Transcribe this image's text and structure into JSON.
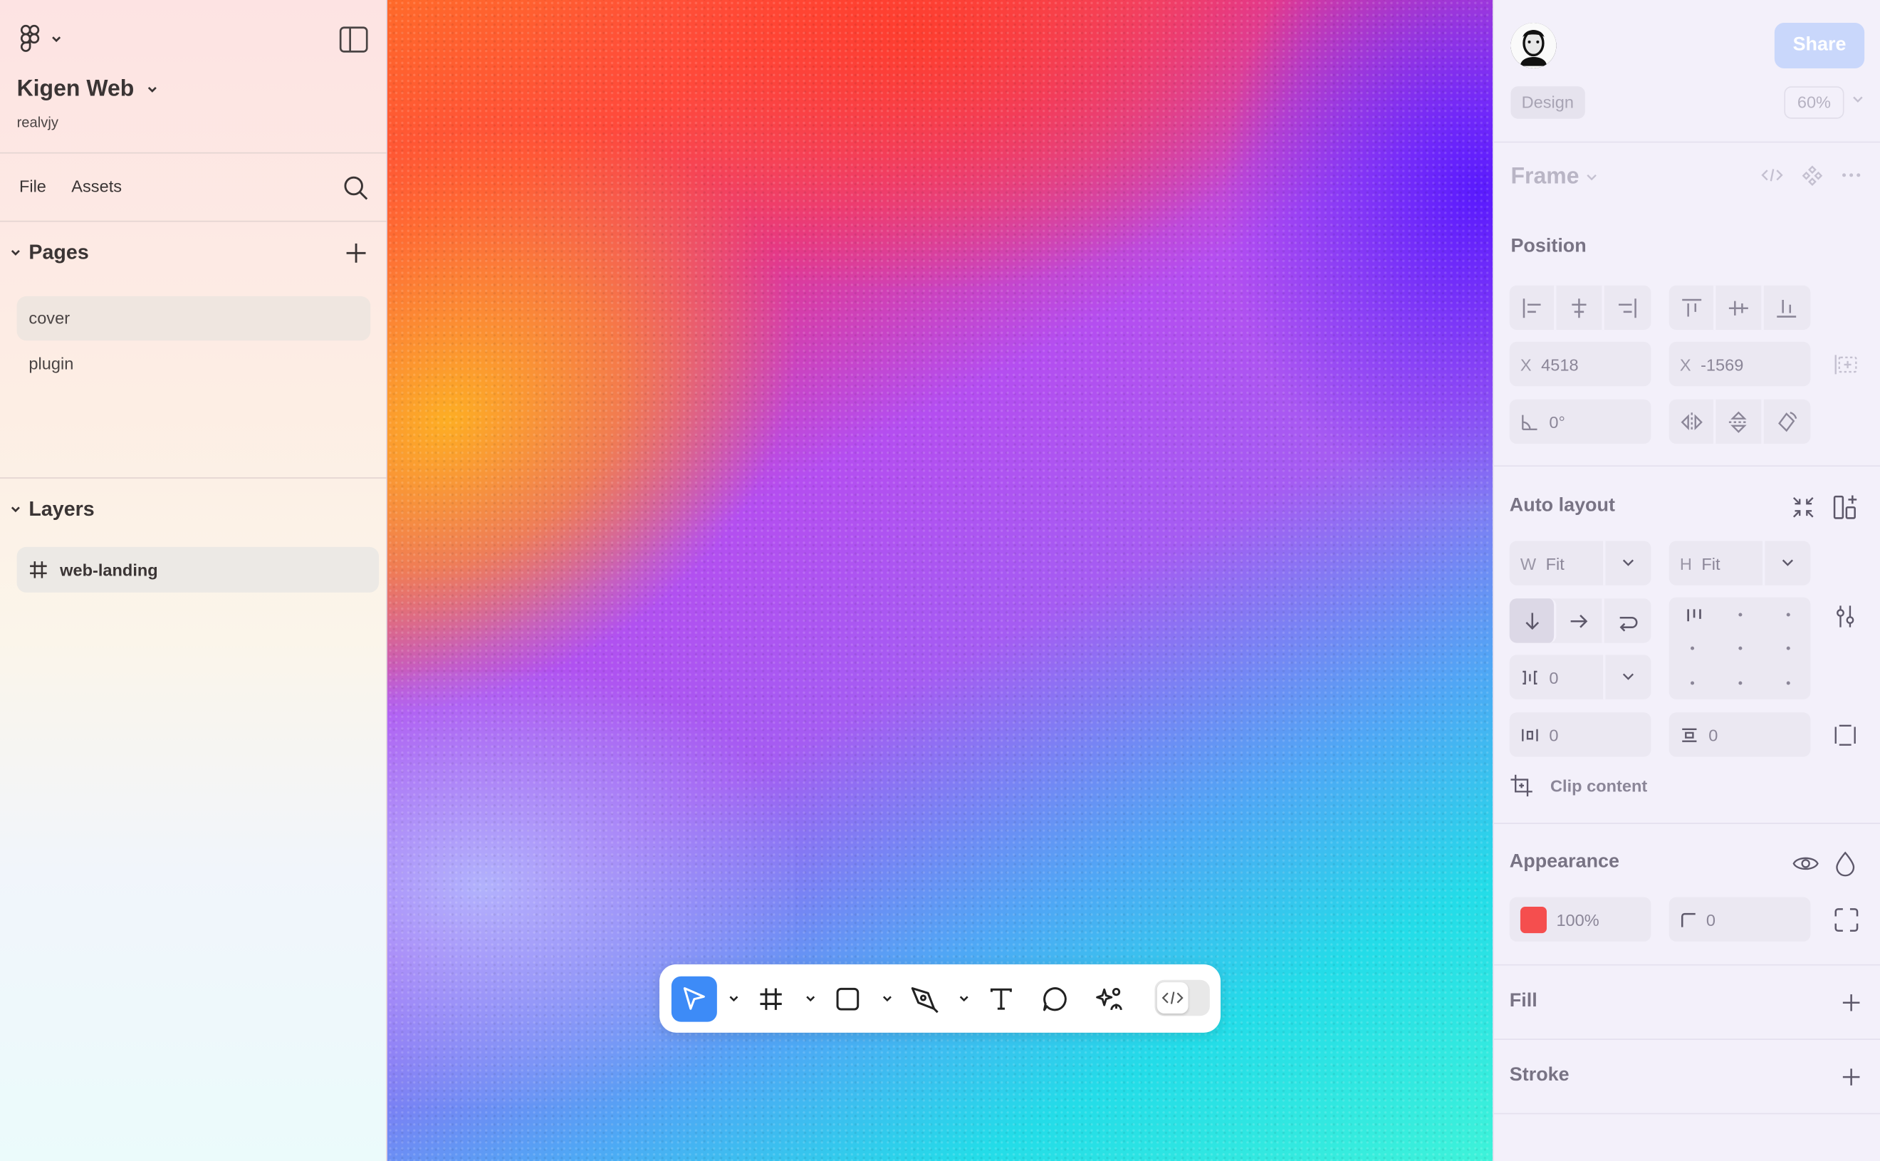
{
  "app": {
    "project_name": "Kigen Web",
    "owner": "realvjy"
  },
  "left_nav": {
    "tabs": [
      "File",
      "Assets"
    ],
    "pages_title": "Pages",
    "pages": [
      {
        "label": "cover",
        "active": true
      },
      {
        "label": "plugin",
        "active": false
      }
    ],
    "layers_title": "Layers",
    "layers": [
      {
        "label": "web-landing",
        "icon": "frame-hash-icon"
      }
    ]
  },
  "toolbar": {
    "tools": [
      "move-tool",
      "frame-tool",
      "rectangle-tool",
      "pen-tool",
      "text-tool",
      "comment-tool",
      "actions-tool"
    ],
    "active_tool": "move-tool",
    "dev_mode_label": "</>"
  },
  "right_panel": {
    "share_label": "Share",
    "mode_tab": "Design",
    "zoom": "60%",
    "selection_type": "Frame",
    "position": {
      "title": "Position",
      "x_label": "X",
      "x_value": "4518",
      "y_label": "X",
      "y_value": "-1569",
      "rotation": "0°"
    },
    "auto_layout": {
      "title": "Auto layout",
      "width_label": "W",
      "width_value": "Fit",
      "height_label": "H",
      "height_value": "Fit",
      "gap": "0",
      "padding_h": "0",
      "padding_v": "0",
      "clip_content_label": "Clip content"
    },
    "appearance": {
      "title": "Appearance",
      "opacity": "100%",
      "corner_radius": "0",
      "color": "#f54e4e"
    },
    "fill_title": "Fill",
    "stroke_title": "Stroke"
  },
  "colors": {
    "accent": "#3d8bf7",
    "share_button": "#c9d7fb",
    "fill_swatch": "#f54e4e"
  }
}
